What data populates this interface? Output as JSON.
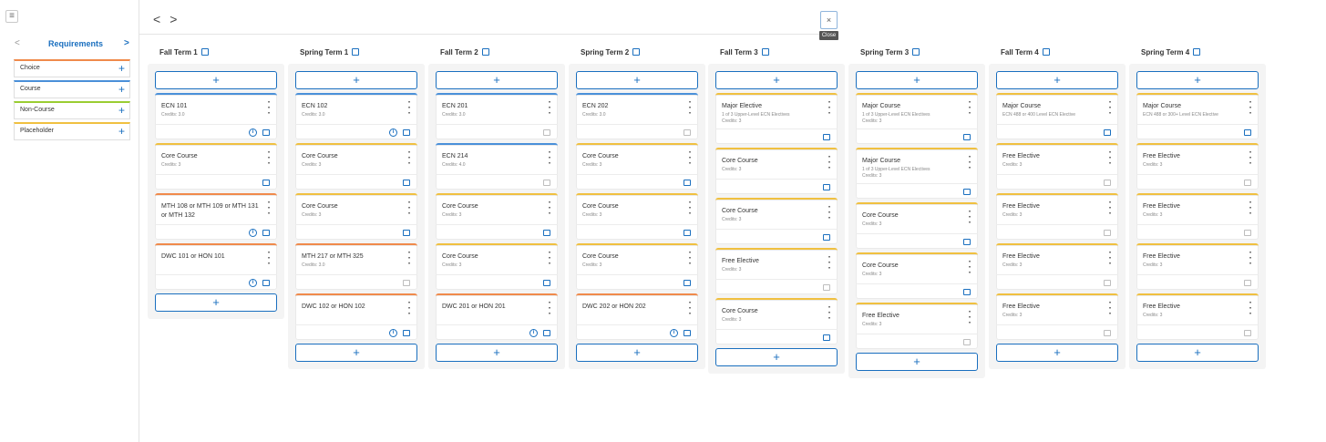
{
  "sidebar": {
    "menu_icon": "hamburger-icon",
    "nav_prev": "<",
    "title": "Requirements",
    "nav_next": ">",
    "items": [
      {
        "label": "Choice",
        "accent": "#f08a4b"
      },
      {
        "label": "Course",
        "accent": "#4a90d9"
      },
      {
        "label": "Non-Course",
        "accent": "#9acd32"
      },
      {
        "label": "Placeholder",
        "accent": "#f0c040"
      }
    ],
    "add_glyph": "+"
  },
  "toolbar": {
    "back_glyph": "<",
    "forward_glyph": ">",
    "close_glyph": "×",
    "close_tooltip": "Close"
  },
  "add_glyph": "+",
  "terms": [
    {
      "title": "Fall Term 1",
      "cards": [
        {
          "name": "ECN 101",
          "sub": "Credits: 3.0",
          "accent": "blue",
          "info": true,
          "note": "blue"
        },
        {
          "name": "Core Course",
          "sub": "Credits: 3",
          "accent": "yellow",
          "info": false,
          "note": "blue"
        },
        {
          "name": "MTH 108 or MTH 109 or MTH 131 or MTH 132",
          "sub": "",
          "accent": "orange",
          "info": true,
          "note": "blue"
        },
        {
          "name": "DWC 101 or HON 101",
          "sub": "",
          "accent": "orange",
          "info": true,
          "note": "blue"
        }
      ]
    },
    {
      "title": "Spring Term 1",
      "cards": [
        {
          "name": "ECN 102",
          "sub": "Credits: 3.0",
          "accent": "blue",
          "info": true,
          "note": "blue"
        },
        {
          "name": "Core Course",
          "sub": "Credits: 3",
          "accent": "yellow",
          "info": false,
          "note": "blue"
        },
        {
          "name": "Core Course",
          "sub": "Credits: 3",
          "accent": "yellow",
          "info": false,
          "note": "blue"
        },
        {
          "name": "MTH 217 or MTH 325",
          "sub": "Credits: 3.0",
          "accent": "orange",
          "info": false,
          "note": "grey"
        },
        {
          "name": "DWC 102 or HON 102",
          "sub": "",
          "accent": "orange",
          "info": true,
          "note": "blue"
        }
      ]
    },
    {
      "title": "Fall Term 2",
      "cards": [
        {
          "name": "ECN 201",
          "sub": "Credits: 3.0",
          "accent": "blue",
          "info": false,
          "note": "grey"
        },
        {
          "name": "ECN 214",
          "sub": "Credits: 4.0",
          "accent": "blue",
          "info": false,
          "note": "grey"
        },
        {
          "name": "Core Course",
          "sub": "Credits: 3",
          "accent": "yellow",
          "info": false,
          "note": "blue"
        },
        {
          "name": "Core Course",
          "sub": "Credits: 3",
          "accent": "yellow",
          "info": false,
          "note": "blue"
        },
        {
          "name": "DWC 201 or HON 201",
          "sub": "",
          "accent": "orange",
          "info": true,
          "note": "blue"
        }
      ]
    },
    {
      "title": "Spring Term 2",
      "cards": [
        {
          "name": "ECN 202",
          "sub": "Credits: 3.0",
          "accent": "blue",
          "info": false,
          "note": "grey"
        },
        {
          "name": "Core Course",
          "sub": "Credits: 3",
          "accent": "yellow",
          "info": false,
          "note": "blue"
        },
        {
          "name": "Core Course",
          "sub": "Credits: 3",
          "accent": "yellow",
          "info": false,
          "note": "blue"
        },
        {
          "name": "Core Course",
          "sub": "Credits: 3",
          "accent": "yellow",
          "info": false,
          "note": "blue"
        },
        {
          "name": "DWC 202 or HON 202",
          "sub": "",
          "accent": "orange",
          "info": true,
          "note": "blue"
        }
      ]
    },
    {
      "title": "Fall Term 3",
      "cards": [
        {
          "name": "Major Elective",
          "sub": "1 of 3 Upper-Level ECN Electives\nCredits: 3",
          "accent": "yellow",
          "info": false,
          "note": "blue"
        },
        {
          "name": "Core Course",
          "sub": "Credits: 3",
          "accent": "yellow",
          "info": false,
          "note": "blue"
        },
        {
          "name": "Core Course",
          "sub": "Credits: 3",
          "accent": "yellow",
          "info": false,
          "note": "blue"
        },
        {
          "name": "Free Elective",
          "sub": "Credits: 3",
          "accent": "yellow",
          "info": false,
          "note": "grey"
        },
        {
          "name": "Core Course",
          "sub": "Credits: 3",
          "accent": "yellow",
          "info": false,
          "note": "blue"
        }
      ]
    },
    {
      "title": "Spring Term 3",
      "cards": [
        {
          "name": "Major Course",
          "sub": "1 of 3 Upper-Level ECN Electives\nCredits: 3",
          "accent": "yellow",
          "info": false,
          "note": "blue"
        },
        {
          "name": "Major Course",
          "sub": "1 of 3 Upper-Level ECN Electives\nCredits: 3",
          "accent": "yellow",
          "info": false,
          "note": "blue"
        },
        {
          "name": "Core Course",
          "sub": "Credits: 3",
          "accent": "yellow",
          "info": false,
          "note": "blue"
        },
        {
          "name": "Core Course",
          "sub": "Credits: 3",
          "accent": "yellow",
          "info": false,
          "note": "blue"
        },
        {
          "name": "Free Elective",
          "sub": "Credits: 3",
          "accent": "yellow",
          "info": false,
          "note": "grey"
        }
      ]
    },
    {
      "title": "Fall Term 4",
      "cards": [
        {
          "name": "Major Course",
          "sub": "ECN 488 or 400 Level ECN Elective",
          "accent": "yellow",
          "info": false,
          "note": "blue"
        },
        {
          "name": "Free Elective",
          "sub": "Credits: 3",
          "accent": "yellow",
          "info": false,
          "note": "grey"
        },
        {
          "name": "Free Elective",
          "sub": "Credits: 3",
          "accent": "yellow",
          "info": false,
          "note": "grey"
        },
        {
          "name": "Free Elective",
          "sub": "Credits: 3",
          "accent": "yellow",
          "info": false,
          "note": "grey"
        },
        {
          "name": "Free Elective",
          "sub": "Credits: 3",
          "accent": "yellow",
          "info": false,
          "note": "grey"
        }
      ]
    },
    {
      "title": "Spring Term 4",
      "cards": [
        {
          "name": "Major Course",
          "sub": "ECN 488 or 300+ Level ECN Elective",
          "accent": "yellow",
          "info": false,
          "note": "blue"
        },
        {
          "name": "Free Elective",
          "sub": "Credits: 3",
          "accent": "yellow",
          "info": false,
          "note": "grey"
        },
        {
          "name": "Free Elective",
          "sub": "Credits: 3",
          "accent": "yellow",
          "info": false,
          "note": "grey"
        },
        {
          "name": "Free Elective",
          "sub": "Credits: 3",
          "accent": "yellow",
          "info": false,
          "note": "grey"
        },
        {
          "name": "Free Elective",
          "sub": "Credits: 3",
          "accent": "yellow",
          "info": false,
          "note": "grey"
        }
      ]
    }
  ]
}
